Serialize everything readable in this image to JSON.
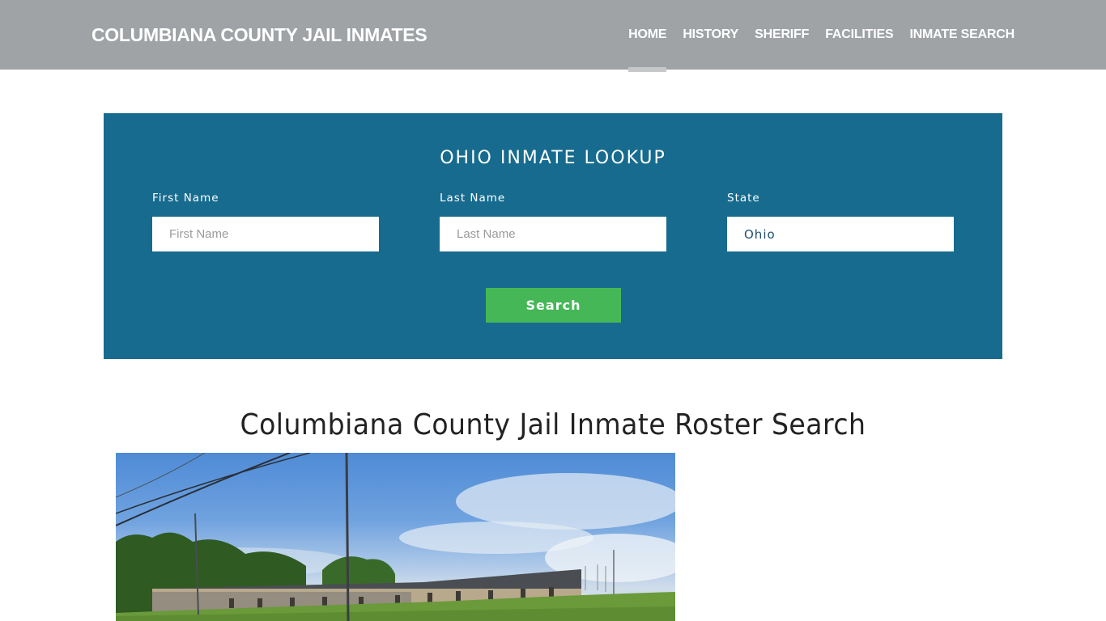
{
  "header": {
    "brand": "COLUMBIANA COUNTY JAIL INMATES",
    "nav": [
      {
        "label": "HOME",
        "active": true
      },
      {
        "label": "HISTORY",
        "active": false
      },
      {
        "label": "SHERIFF",
        "active": false
      },
      {
        "label": "FACILITIES",
        "active": false
      },
      {
        "label": "INMATE SEARCH",
        "active": false
      }
    ]
  },
  "lookup": {
    "title": "OHIO INMATE LOOKUP",
    "first_name": {
      "label": "First Name",
      "placeholder": "First Name",
      "value": ""
    },
    "last_name": {
      "label": "Last Name",
      "placeholder": "Last Name",
      "value": ""
    },
    "state": {
      "label": "State",
      "value": "Ohio"
    },
    "search_label": "Search"
  },
  "main": {
    "title": "Columbiana County Jail Inmate Roster Search",
    "photo_alt": "Columbiana County Jail facility exterior"
  },
  "colors": {
    "header_bg": "#9fa3a6",
    "lookup_bg": "#176b8e",
    "search_button": "#45b757"
  }
}
